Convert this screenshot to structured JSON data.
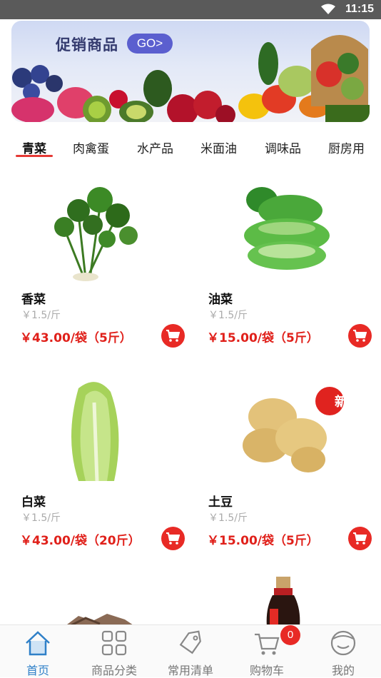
{
  "status_bar": {
    "time": "11:15"
  },
  "banner": {
    "title": "促销商品",
    "go_label": "GO>"
  },
  "tabs": [
    {
      "label": "青菜",
      "active": true
    },
    {
      "label": "肉禽蛋",
      "active": false
    },
    {
      "label": "水产品",
      "active": false
    },
    {
      "label": "米面油",
      "active": false
    },
    {
      "label": "调味品",
      "active": false
    },
    {
      "label": "厨房用",
      "active": false
    }
  ],
  "products": [
    {
      "name": "香菜",
      "unit_price": "￥1.5/斤",
      "price": "￥43.00/袋（5斤）",
      "image": "coriander"
    },
    {
      "name": "油菜",
      "unit_price": "￥1.5/斤",
      "price": "￥15.00/袋（5斤）",
      "image": "bok-choy"
    },
    {
      "name": "白菜",
      "unit_price": "￥1.5/斤",
      "price": "￥43.00/袋（20斤）",
      "image": "napa-cabbage"
    },
    {
      "name": "土豆",
      "unit_price": "￥1.5/斤",
      "price": "￥15.00/袋（5斤）",
      "image": "potato",
      "badge": "新"
    }
  ],
  "bottom_nav": [
    {
      "label": "首页",
      "icon": "home-icon",
      "active": true
    },
    {
      "label": "商品分类",
      "icon": "category-grid-icon",
      "active": false
    },
    {
      "label": "常用清单",
      "icon": "tag-icon",
      "active": false
    },
    {
      "label": "购物车",
      "icon": "cart-icon",
      "active": false
    },
    {
      "label": "我的",
      "icon": "profile-icon",
      "active": false
    }
  ],
  "cart_badge": "0",
  "colors": {
    "accent": "#e53935",
    "price": "#e0201a",
    "nav_active": "#2f80c8"
  }
}
